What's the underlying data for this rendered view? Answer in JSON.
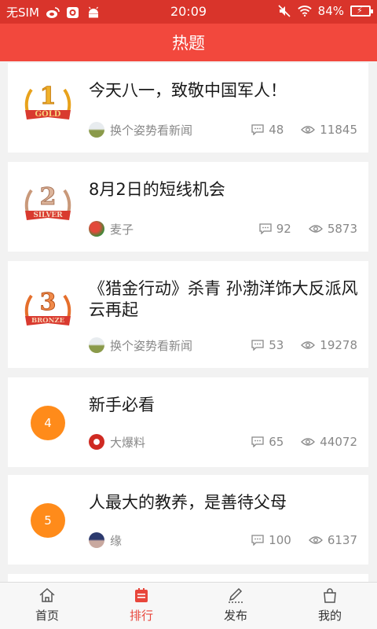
{
  "status_bar": {
    "carrier": "无SIM",
    "time": "20:09",
    "battery": "84%"
  },
  "header": {
    "title": "热题"
  },
  "posts": [
    {
      "rank": "1",
      "medal_word": "GOLD",
      "medal_color": "#e8a21c",
      "title": "今天八一，致敬中国军人！",
      "author": "换个姿势看新闻",
      "comments": "48",
      "views": "11845"
    },
    {
      "rank": "2",
      "medal_word": "SILVER",
      "medal_color": "#c9997a",
      "title": "8月2日的短线机会",
      "author": "麦子",
      "comments": "92",
      "views": "5873"
    },
    {
      "rank": "3",
      "medal_word": "BRONZE",
      "medal_color": "#e56f2c",
      "title": "《猎金行动》杀青 孙渤洋饰大反派风云再起",
      "author": "换个姿势看新闻",
      "comments": "53",
      "views": "19278"
    },
    {
      "rank": "4",
      "title": "新手必看",
      "author": "大爆料",
      "comments": "65",
      "views": "44072"
    },
    {
      "rank": "5",
      "title": "人最大的教养，是善待父母",
      "author": "缘",
      "comments": "100",
      "views": "6137"
    }
  ],
  "tabs": [
    {
      "label": "首页",
      "icon": "home-icon"
    },
    {
      "label": "排行",
      "icon": "ranking-icon"
    },
    {
      "label": "发布",
      "icon": "pencil-icon"
    },
    {
      "label": "我的",
      "icon": "bag-icon"
    }
  ],
  "colors": {
    "status_bar": "#d9342b",
    "title_bar": "#f2483d",
    "accent": "#e8463b",
    "rank_circle": "#ff8b1a"
  }
}
